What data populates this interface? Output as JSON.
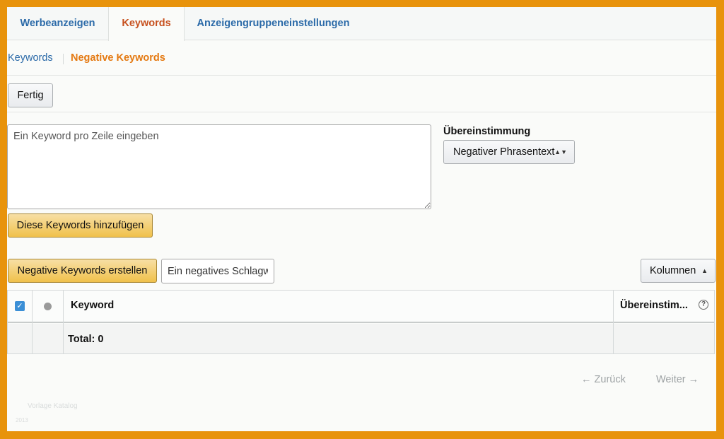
{
  "tabs": [
    {
      "label": "Werbeanzeigen",
      "active": false
    },
    {
      "label": "Keywords",
      "active": true
    },
    {
      "label": "Anzeigengruppeneinstellungen",
      "active": false
    }
  ],
  "subnav": {
    "keywords": "Keywords",
    "negative_keywords": "Negative Keywords"
  },
  "done_button": "Fertig",
  "keyword_input": {
    "placeholder": "Ein Keyword pro Zeile eingeben",
    "value": ""
  },
  "match": {
    "label": "Übereinstimmung",
    "selected": "Negativer Phrasentext"
  },
  "add_keywords_button": "Diese Keywords hinzufügen",
  "create_negative_button": "Negative Keywords erstellen",
  "search": {
    "placeholder": "Ein negatives Schlagwort"
  },
  "columns_button": "Kolumnen",
  "table": {
    "headers": {
      "keyword": "Keyword",
      "match": "Übereinstim..."
    },
    "total_label": "Total: 0"
  },
  "pager": {
    "prev": "← Zurück",
    "next": "Weiter →"
  },
  "watermark": {
    "line1": "Vorlage Katalog",
    "line2": "2013"
  },
  "colors": {
    "accent_orange": "#e47911",
    "link_blue": "#2b6aa8",
    "frame_border": "#e8930c",
    "primary_button": "#f0c14b"
  }
}
